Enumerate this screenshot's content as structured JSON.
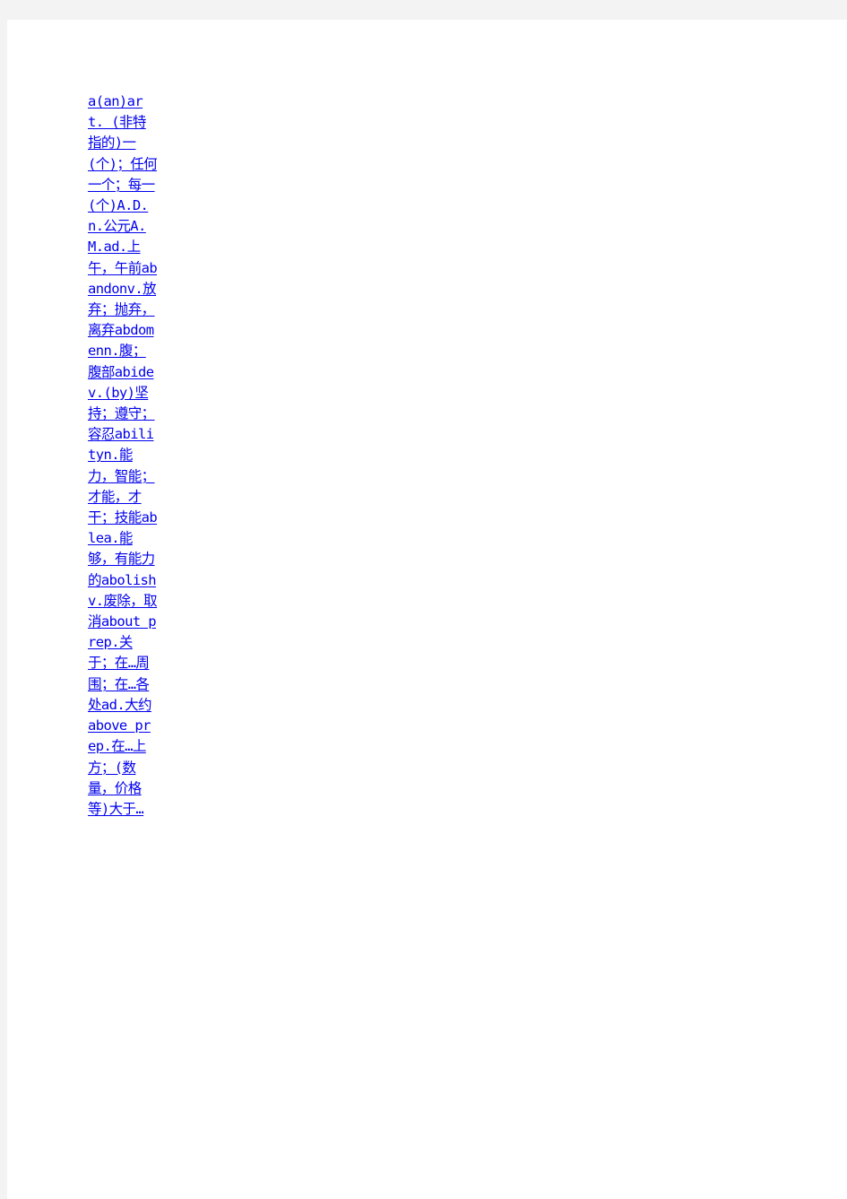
{
  "document": {
    "entries": [
      {
        "word": "a(an)",
        "definition": "art. (非特指的)一(个)；任何一个；每一(个)"
      },
      {
        "word": "A.D.",
        "definition": "n.公元"
      },
      {
        "word": "A.M.",
        "definition": "ad.上午，午前"
      },
      {
        "word": "abandon",
        "definition": "v.放弃；抛弃，离弃"
      },
      {
        "word": "abdomen",
        "definition": "n.腹；腹部"
      },
      {
        "word": "abide",
        "definition": "v.(by)坚持；遵守；容忍"
      },
      {
        "word": "ability",
        "definition": "n.能力，智能；才能，才干；技能"
      },
      {
        "word": "able",
        "definition": "a.能够，有能力的"
      },
      {
        "word": "abolish",
        "definition": "v.废除，取消"
      },
      {
        "word": "about",
        "definition": "prep.关于；在…周围；在…各处 ad.大约"
      },
      {
        "word": "above",
        "definition": "prep.在…上方；(数量，价格等)大于…"
      }
    ],
    "link_text": "a(an)art. (非特指的)一(个)；任何一个；每一(个)A.D.n.公元A.M.ad.上午，午前abandonv.放弃；抛弃，离弃abdomenn.腹；腹部abidev.(by)坚持；遵守；容忍abilityn.能力，智能；才能，才干；技能ablea.能够，有能力的abolishv.废除，取消about prep.关于；在…周围；在…各处ad.大约above prep.在…上方；(数量，价格等)大于…"
  },
  "colors": {
    "background": "#f3f3f3",
    "page": "#ffffff",
    "link": "#0000ee"
  }
}
